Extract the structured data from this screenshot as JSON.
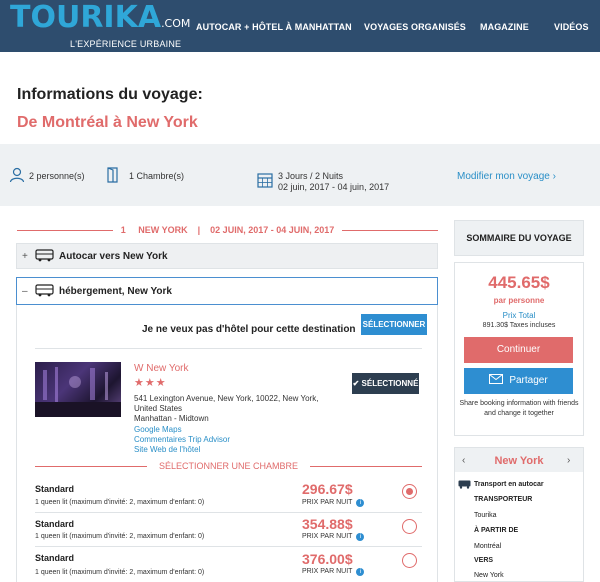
{
  "header": {
    "logo_main": "TOURIKA",
    "logo_com": ".COM",
    "logo_tag": "L'EXPÉRIENCE URBAINE",
    "nav": [
      "AUTOCAR + HÔTEL À MANHATTAN",
      "VOYAGES ORGANISÉS",
      "MAGAZINE",
      "VIDÉOS"
    ]
  },
  "page": {
    "title": "Informations du voyage:",
    "route": "De Montréal à New York"
  },
  "info": {
    "persons": "2 personne(s)",
    "rooms": "1 Chambre(s)",
    "duration": "3 Jours / 2 Nuits",
    "dates": "02 juin, 2017 - 04 juin, 2017",
    "modify": "Modifier mon voyage"
  },
  "itinerary": {
    "step": "1",
    "city": "NEW YORK",
    "separator": "|",
    "dates": "02 JUIN, 2017 - 04 JUIN, 2017",
    "sections": [
      {
        "sign": "+",
        "label": "Autocar vers New York"
      },
      {
        "sign": "–",
        "label": "hébergement, New York"
      }
    ]
  },
  "hotel_section": {
    "no_hotel": "Je ne veux pas d'hôtel pour cette destination",
    "select_btn": "SÉLECTIONNER",
    "hotel": {
      "name": "W New York",
      "stars": "★★★",
      "address": [
        "541 Lexington Avenue, New York, 10022, New York,",
        "United States",
        "Manhattan - Midtown"
      ],
      "links": [
        "Google Maps",
        "Commentaires Trip Advisor",
        "Site Web de l'hôtel"
      ],
      "selected_btn": "SÉLECTIONNÉ"
    },
    "room_heading": "SÉLECTIONNER UNE CHAMBRE",
    "rooms": [
      {
        "name": "Standard",
        "desc": "1 queen lit (maximum d'invité: 2, maximum d'enfant: 0)",
        "price": "296.67$",
        "per": "PRIX PAR NUIT",
        "selected": true
      },
      {
        "name": "Standard",
        "desc": "1 queen lit (maximum d'invité: 2, maximum d'enfant: 0)",
        "price": "354.88$",
        "per": "PRIX PAR NUIT",
        "selected": false
      },
      {
        "name": "Standard",
        "desc": "1 queen lit (maximum d'invité: 2, maximum d'enfant: 0)",
        "price": "376.00$",
        "per": "PRIX PAR NUIT",
        "selected": false
      }
    ],
    "info_glyph": "i"
  },
  "summary": {
    "heading": "SOMMAIRE DU VOYAGE",
    "price": "445.65$",
    "per_person": "par personne",
    "total_label": "Prix Total",
    "total_value": "891.30$ Taxes incluses",
    "continue": "Continuer",
    "share": "Partager",
    "share_note": "Share booking information with friends and change it together",
    "detail": {
      "city": "New York",
      "transport_title": "Transport en autocar",
      "carrier_label": "TRANSPORTEUR",
      "carrier": "Tourika",
      "from_label": "À PARTIR DE",
      "from": "Montréal",
      "to_label": "VERS",
      "to": "New York"
    }
  },
  "colors": {
    "header_bg": "#2e4d6e",
    "brand_blue": "#2fa7d8",
    "accent_red": "#e06b6b",
    "button_blue": "#2e8ed1",
    "dark_button": "#2d3e50",
    "info_bg": "#eef1f3"
  }
}
